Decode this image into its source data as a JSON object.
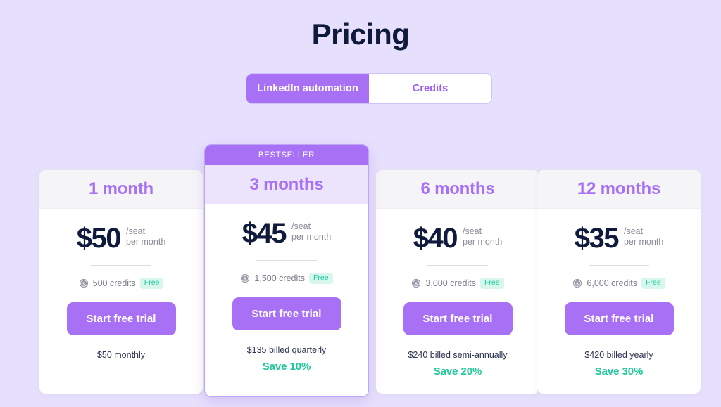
{
  "page": {
    "title": "Pricing",
    "background_color": "#E6E0FD",
    "accent_color": "#A770F5",
    "title_color": "#0F1A3D",
    "save_color": "#20C89C"
  },
  "toggle": {
    "options": [
      {
        "label": "LinkedIn automation",
        "active": true
      },
      {
        "label": "Credits",
        "active": false
      }
    ]
  },
  "cards": [
    {
      "term": "1 month",
      "featured": false,
      "ribbon": "",
      "price": "$50",
      "unit_line1": "/seat",
      "unit_line2": "per month",
      "credits": "500 credits",
      "credits_badge": "Free",
      "credits_icon": "coin-dollar-icon",
      "cta": "Start free trial",
      "billed": "$50 monthly",
      "save": ""
    },
    {
      "term": "3 months",
      "featured": true,
      "ribbon": "BESTSELLER",
      "price": "$45",
      "unit_line1": "/seat",
      "unit_line2": "per month",
      "credits": "1,500 credits",
      "credits_badge": "Free",
      "credits_icon": "coin-dollar-icon",
      "cta": "Start free trial",
      "billed": "$135 billed quarterly",
      "save": "Save 10%"
    },
    {
      "term": "6 months",
      "featured": false,
      "ribbon": "",
      "price": "$40",
      "unit_line1": "/seat",
      "unit_line2": "per month",
      "credits": "3,000 credits",
      "credits_badge": "Free",
      "credits_icon": "coin-dollar-icon",
      "cta": "Start free trial",
      "billed": "$240 billed semi-annually",
      "save": "Save 20%"
    },
    {
      "term": "12 months",
      "featured": false,
      "ribbon": "",
      "price": "$35",
      "unit_line1": "/seat",
      "unit_line2": "per month",
      "credits": "6,000 credits",
      "credits_badge": "Free",
      "credits_icon": "coin-dollar-icon",
      "cta": "Start free trial",
      "billed": "$420 billed yearly",
      "save": "Save 30%"
    }
  ]
}
